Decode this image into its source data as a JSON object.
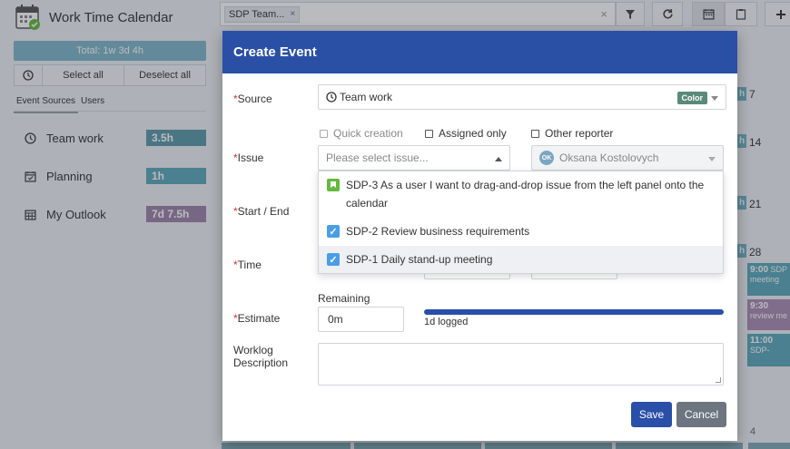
{
  "app": {
    "title": "Work Time Calendar"
  },
  "sidebar": {
    "total": "Total: 1w 3d 4h",
    "select_all": "Select all",
    "deselect_all": "Deselect all",
    "tabs": [
      "Event Sources",
      "Users"
    ],
    "sources": [
      {
        "label": "Team work",
        "time": "3.5h",
        "color": "#5b9aa8",
        "icon": "clock-icon"
      },
      {
        "label": "Planning",
        "time": "1h",
        "color": "#5aa9b8",
        "icon": "calendar-check-icon"
      },
      {
        "label": "My Outlook",
        "time": "7d 7.5h",
        "color": "#9d84a8",
        "icon": "calendar-grid-icon"
      }
    ]
  },
  "topbar": {
    "filter_chip": "SDP Team...",
    "chip_remove": "×",
    "clear": "×"
  },
  "calendar": {
    "days": [
      "7",
      "14",
      "21",
      "28"
    ],
    "events": [
      {
        "time": "9:00",
        "text": "SDP",
        "sub": "meeting"
      },
      {
        "time": "9:30",
        "text": "",
        "sub": "review me"
      },
      {
        "time": "11:00",
        "text": "SDP-",
        "sub": ""
      }
    ],
    "more": "4"
  },
  "modal": {
    "title": "Create Event",
    "source_label": "Source",
    "source_value": "Team work",
    "color_badge": "Color",
    "quick_creation": "Quick creation",
    "assigned_only": "Assigned only",
    "other_reporter": "Other reporter",
    "issue_label": "Issue",
    "issue_placeholder": "Please select issue...",
    "assignee": "Oksana Kostolovych",
    "assignee_initials": "OK",
    "start_end_label": "Start / End",
    "time_label": "Time",
    "estimate_label": "Estimate",
    "remaining_label": "Remaining",
    "estimate_value": "0m",
    "logged": "1d logged",
    "worklog_label_1": "Worklog",
    "worklog_label_2": "Description",
    "save": "Save",
    "cancel": "Cancel",
    "issues": [
      {
        "key": "SDP-3",
        "text": "SDP-3 As a user I want to drag-and-drop issue from the left panel onto the",
        "text2": "calendar",
        "type": "story"
      },
      {
        "key": "SDP-2",
        "text": "SDP-2 Review business requirements",
        "type": "task"
      },
      {
        "key": "SDP-1",
        "text": "SDP-1 Daily stand-up meeting",
        "type": "task"
      }
    ]
  }
}
